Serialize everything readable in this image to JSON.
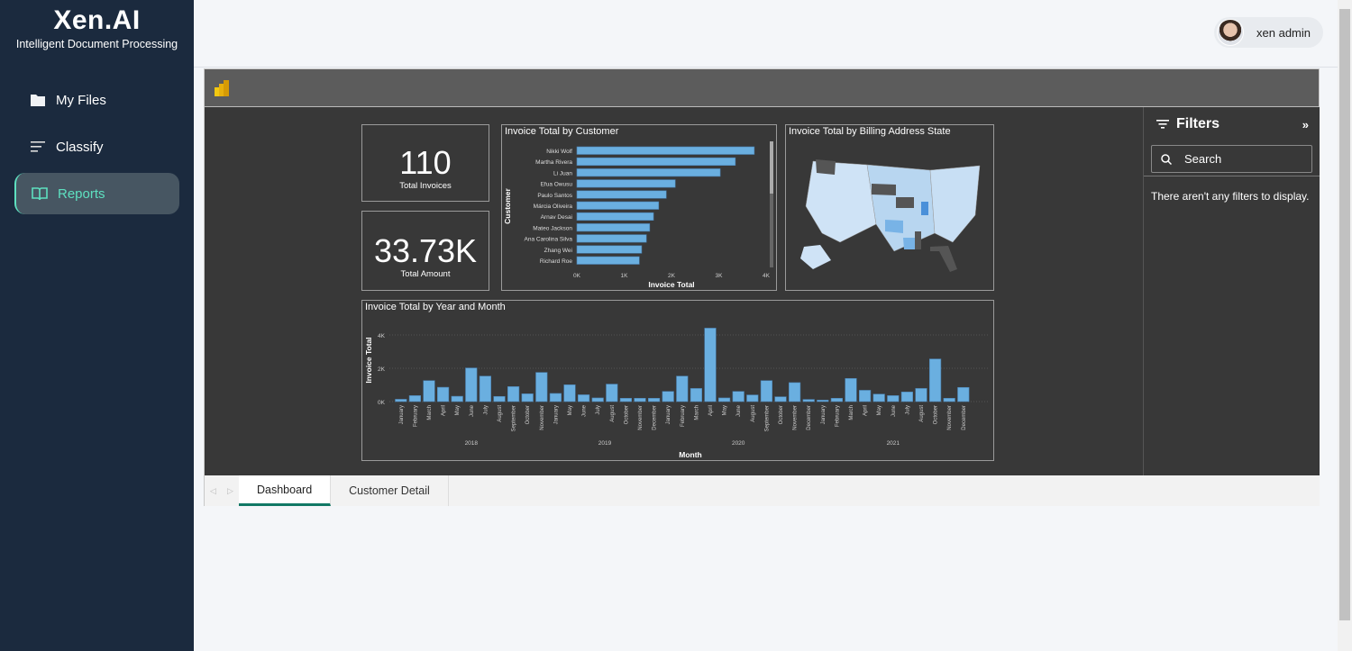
{
  "app": {
    "title": "Xen.AI",
    "subtitle": "Intelligent Document Processing"
  },
  "sidebar": {
    "items": [
      {
        "label": "My Files",
        "icon": "folder-icon"
      },
      {
        "label": "Classify",
        "icon": "lines-icon"
      },
      {
        "label": "Reports",
        "icon": "book-icon",
        "active": true
      }
    ]
  },
  "user": {
    "name": "xen admin"
  },
  "report": {
    "cards": [
      {
        "value": "110",
        "label": "Total Invoices"
      },
      {
        "value": "33.73K",
        "label": "Total Amount"
      }
    ],
    "customer_chart": {
      "title": "Invoice Total by Customer",
      "ylabel": "Customer",
      "xlabel": "Invoice Total"
    },
    "map": {
      "title": "Invoice Total by Billing Address State"
    },
    "month_chart": {
      "title": "Invoice Total by Year and Month",
      "ylabel": "Invoice Total",
      "xlabel": "Month"
    },
    "filters": {
      "title": "Filters",
      "search_placeholder": "Search",
      "empty": "There aren't any filters to display."
    },
    "tabs": [
      {
        "label": "Dashboard",
        "active": true
      },
      {
        "label": "Customer Detail"
      }
    ]
  },
  "chart_data": [
    {
      "type": "bar",
      "orientation": "horizontal",
      "title": "Invoice Total by Customer",
      "xlabel": "Invoice Total",
      "ylabel": "Customer",
      "categories": [
        "Nikki Wolf",
        "Martha Rivera",
        "Li Juan",
        "Efua Owusu",
        "Paulo Santos",
        "Márcia Oliveira",
        "Arnav Desai",
        "Mateo Jackson",
        "Ana Carolina Silva",
        "Zhang Wei",
        "Richard Roe"
      ],
      "values": [
        3750,
        3350,
        3030,
        2080,
        1890,
        1730,
        1620,
        1540,
        1470,
        1370,
        1320
      ],
      "xticks": [
        "0K",
        "1K",
        "2K",
        "3K",
        "4K"
      ],
      "xlim": [
        0,
        4000
      ],
      "color": "#6aafe0"
    },
    {
      "type": "bar",
      "title": "Invoice Total by Year and Month",
      "xlabel": "Month",
      "ylabel": "Invoice Total",
      "yticks": [
        "0K",
        "2K",
        "4K"
      ],
      "ylim": [
        0,
        4500
      ],
      "color": "#6aafe0",
      "groups": [
        {
          "year": "2018",
          "months": [
            "January",
            "February",
            "March",
            "April",
            "May",
            "June",
            "July",
            "August",
            "September",
            "October",
            "November"
          ],
          "values": [
            140,
            360,
            1260,
            860,
            320,
            2020,
            1530,
            310,
            900,
            470,
            1750
          ]
        },
        {
          "year": "2019",
          "months": [
            "January",
            "May",
            "June",
            "July",
            "August",
            "October",
            "November",
            "December"
          ],
          "values": [
            490,
            1010,
            410,
            220,
            1050,
            200,
            200,
            200
          ]
        },
        {
          "year": "2020",
          "months": [
            "January",
            "February",
            "March",
            "April",
            "May",
            "June",
            "August",
            "September",
            "October",
            "November",
            "December"
          ],
          "values": [
            610,
            1530,
            790,
            4410,
            220,
            610,
            400,
            1260,
            290,
            1140,
            130
          ]
        },
        {
          "year": "2021",
          "months": [
            "January",
            "February",
            "March",
            "April",
            "May",
            "June",
            "July",
            "August",
            "October",
            "November",
            "December"
          ],
          "values": [
            90,
            200,
            1390,
            680,
            450,
            360,
            580,
            790,
            2560,
            200,
            850
          ]
        }
      ]
    }
  ]
}
